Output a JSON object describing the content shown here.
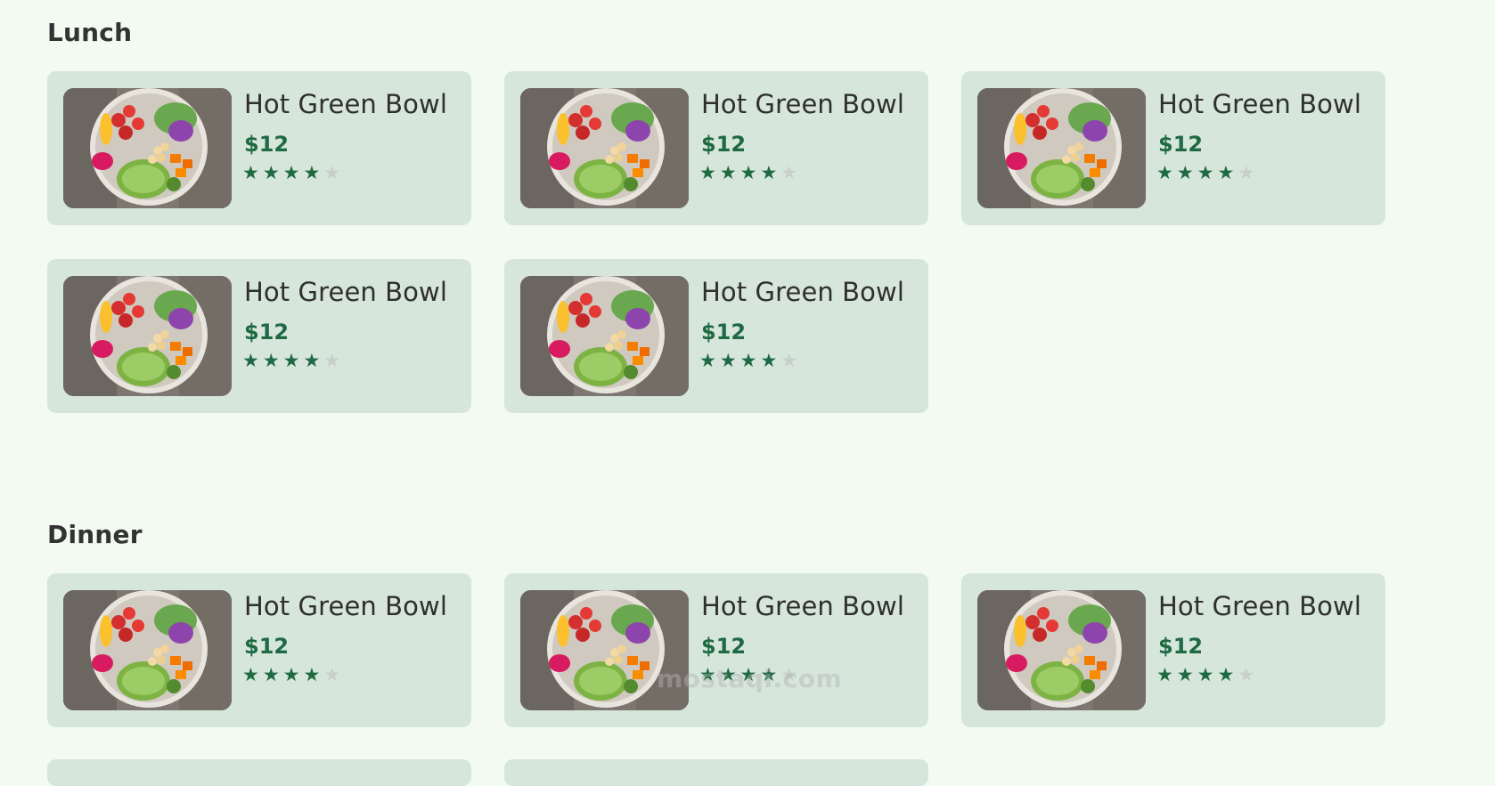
{
  "colors": {
    "page_bg": "#f2faf1",
    "card_bg": "#d6e6db",
    "accent": "#1f6a43",
    "star_off": "#c8cfcb",
    "text": "#2f2f2f"
  },
  "sections": [
    {
      "title": "Lunch",
      "items": [
        {
          "name": "Hot Green Bowl",
          "price": "$12",
          "rating": 4,
          "max_rating": 5
        },
        {
          "name": "Hot Green Bowl",
          "price": "$12",
          "rating": 4,
          "max_rating": 5
        },
        {
          "name": "Hot Green Bowl",
          "price": "$12",
          "rating": 4,
          "max_rating": 5
        },
        {
          "name": "Hot Green Bowl",
          "price": "$12",
          "rating": 4,
          "max_rating": 5
        },
        {
          "name": "Hot Green Bowl",
          "price": "$12",
          "rating": 4,
          "max_rating": 5
        }
      ]
    },
    {
      "title": "Dinner",
      "items": [
        {
          "name": "Hot Green Bowl",
          "price": "$12",
          "rating": 4,
          "max_rating": 5
        },
        {
          "name": "Hot Green Bowl",
          "price": "$12",
          "rating": 4,
          "max_rating": 5
        },
        {
          "name": "Hot Green Bowl",
          "price": "$12",
          "rating": 4,
          "max_rating": 5
        }
      ]
    }
  ],
  "icons": {
    "star": "star-icon",
    "food_image": "salad-bowl-image"
  },
  "watermark": "mostaqi.com"
}
